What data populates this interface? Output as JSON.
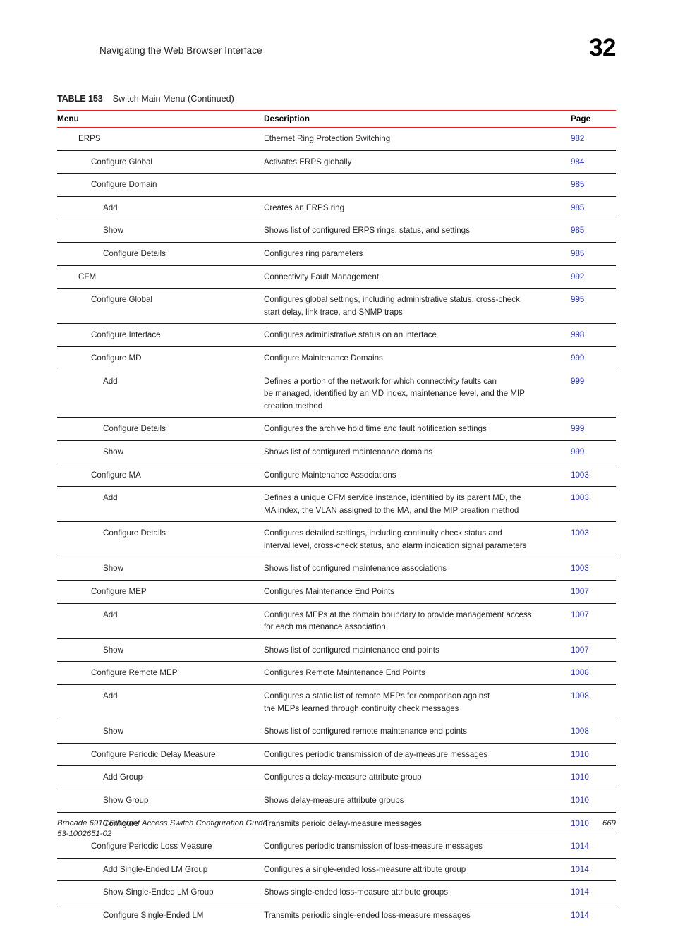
{
  "header": {
    "running_title": "Navigating the Web Browser Interface",
    "chapter_number": "32"
  },
  "table": {
    "caption_label": "TABLE 153",
    "caption_text": "Switch Main Menu (Continued)",
    "accent_color": "#e01b24",
    "link_color": "#2b35c8",
    "columns": [
      "Menu",
      "Description",
      "Page"
    ],
    "rows": [
      {
        "menu": "ERPS",
        "level": 1,
        "description": [
          "Ethernet Ring Protection Switching"
        ],
        "page": "982"
      },
      {
        "menu": "Configure Global",
        "level": 2,
        "description": [
          "Activates ERPS globally"
        ],
        "page": "984"
      },
      {
        "menu": "Configure Domain",
        "level": 2,
        "description": [
          ""
        ],
        "page": "985"
      },
      {
        "menu": "Add",
        "level": 3,
        "description": [
          "Creates an ERPS ring"
        ],
        "page": "985"
      },
      {
        "menu": "Show",
        "level": 3,
        "description": [
          "Shows list of configured ERPS rings, status, and settings"
        ],
        "page": "985"
      },
      {
        "menu": "Configure Details",
        "level": 3,
        "description": [
          "Configures ring parameters"
        ],
        "page": "985"
      },
      {
        "menu": "CFM",
        "level": 1,
        "description": [
          "Connectivity Fault Management"
        ],
        "page": "992"
      },
      {
        "menu": "Configure Global",
        "level": 2,
        "description": [
          "Configures global settings, including administrative status, cross-check",
          "start delay, link trace, and SNMP traps"
        ],
        "page": "995"
      },
      {
        "menu": "Configure Interface",
        "level": 2,
        "description": [
          "Configures administrative status on an interface"
        ],
        "page": "998"
      },
      {
        "menu": "Configure MD",
        "level": 2,
        "description": [
          "Configure Maintenance Domains"
        ],
        "page": "999"
      },
      {
        "menu": "Add",
        "level": 3,
        "description": [
          "Defines a portion of the network for which connectivity faults can",
          "be managed, identified by an MD index, maintenance level, and the MIP",
          "creation method"
        ],
        "page": "999"
      },
      {
        "menu": "Configure Details",
        "level": 3,
        "description": [
          "Configures the archive hold time and fault notification settings"
        ],
        "page": "999"
      },
      {
        "menu": "Show",
        "level": 3,
        "description": [
          "Shows list of configured maintenance domains"
        ],
        "page": "999"
      },
      {
        "menu": "Configure MA",
        "level": 2,
        "description": [
          "Configure Maintenance Associations"
        ],
        "page": "1003"
      },
      {
        "menu": "Add",
        "level": 3,
        "description": [
          "Defines a unique CFM service instance, identified by its parent MD, the",
          "MA index, the VLAN assigned to the MA, and the MIP creation method"
        ],
        "page": "1003"
      },
      {
        "menu": "Configure Details",
        "level": 3,
        "description": [
          "Configures detailed settings, including continuity check status and",
          "interval level, cross-check status, and alarm indication signal parameters"
        ],
        "page": "1003"
      },
      {
        "menu": "Show",
        "level": 3,
        "description": [
          "Shows list of configured maintenance associations"
        ],
        "page": "1003"
      },
      {
        "menu": "Configure MEP",
        "level": 2,
        "description": [
          "Configures Maintenance End Points"
        ],
        "page": "1007"
      },
      {
        "menu": "Add",
        "level": 3,
        "description": [
          "Configures MEPs at the domain boundary to provide management access",
          "for each maintenance association"
        ],
        "page": "1007"
      },
      {
        "menu": "Show",
        "level": 3,
        "description": [
          "Shows list of configured maintenance end points"
        ],
        "page": "1007"
      },
      {
        "menu": "Configure Remote MEP",
        "level": 2,
        "description": [
          "Configures Remote Maintenance End Points"
        ],
        "page": "1008"
      },
      {
        "menu": "Add",
        "level": 3,
        "description": [
          "Configures a static list of remote MEPs for comparison against",
          "the MEPs learned through continuity check messages"
        ],
        "page": "1008"
      },
      {
        "menu": "Show",
        "level": 3,
        "description": [
          "Shows list of configured remote maintenance end points"
        ],
        "page": "1008"
      },
      {
        "menu": "Configure Periodic Delay Measure",
        "level": 2,
        "description": [
          "Configures periodic transmission of delay-measure messages"
        ],
        "page": "1010"
      },
      {
        "menu": "Add Group",
        "level": 3,
        "description": [
          "Configures a delay-measure attribute group"
        ],
        "page": "1010"
      },
      {
        "menu": "Show Group",
        "level": 3,
        "description": [
          "Shows delay-measure attribute groups"
        ],
        "page": "1010"
      },
      {
        "menu": "Configure",
        "level": 3,
        "description": [
          "Transmits perioic delay-measure messages"
        ],
        "page": "1010"
      },
      {
        "menu": "Configure Periodic Loss Measure",
        "level": 2,
        "description": [
          "Configures periodic transmission of loss-measure messages"
        ],
        "page": "1014"
      },
      {
        "menu": "Add Single-Ended LM Group",
        "level": 3,
        "description": [
          "Configures a single-ended loss-measure attribute group"
        ],
        "page": "1014"
      },
      {
        "menu": "Show Single-Ended LM Group",
        "level": 3,
        "description": [
          "Shows single-ended loss-measure attribute groups"
        ],
        "page": "1014"
      },
      {
        "menu": "Configure Single-Ended LM",
        "level": 3,
        "description": [
          "Transmits periodic single-ended loss-measure messages"
        ],
        "page": "1014"
      }
    ]
  },
  "footer": {
    "guide_title": "Brocade 6910 Ethernet Access Switch Configuration Guide",
    "part_number": "53-1002651-02",
    "page_number": "669"
  }
}
